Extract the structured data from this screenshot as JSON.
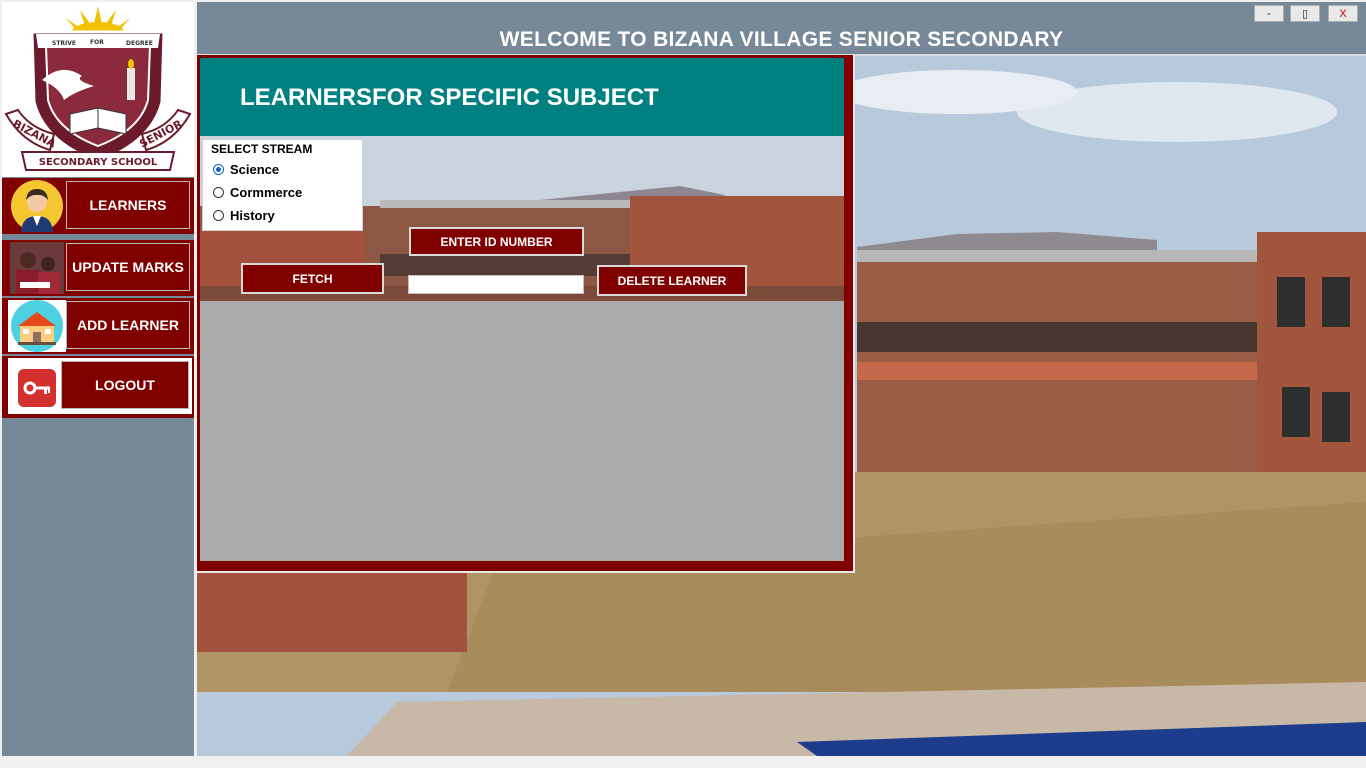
{
  "window": {
    "title": "WELCOME TO BIZANA VILLAGE SENIOR SECONDARY",
    "minimize_label": "-",
    "maximize_label": "▯",
    "close_label": "X"
  },
  "logo": {
    "motto_left": "STRIVE",
    "motto_center": "FOR",
    "motto_right": "DEGREE",
    "banner_left": "BIZANA",
    "banner_right": "SENIOR",
    "banner_bottom": "SECONDARY SCHOOL"
  },
  "sidebar": {
    "items": [
      {
        "label": "LEARNERS",
        "icon": "student-avatar-icon"
      },
      {
        "label": "UPDATE MARKS",
        "icon": "students-photo-icon"
      },
      {
        "label": "ADD LEARNER",
        "icon": "school-building-icon"
      },
      {
        "label": "LOGOUT",
        "icon": "key-icon"
      }
    ]
  },
  "panel": {
    "title": "LEARNERSFOR SPECIFIC SUBJECT",
    "stream_group": {
      "legend": "SELECT STREAM",
      "options": [
        "Science",
        "Cormmerce",
        "History"
      ],
      "selected": "Science"
    },
    "enter_id_label": "ENTER ID NUMBER",
    "id_input_value": "",
    "fetch_label": "FETCH",
    "delete_label": "DELETE LEARNER"
  },
  "colors": {
    "maroon": "#800000",
    "teal": "#008080",
    "slate": "#778899",
    "grid_gray": "#ababab",
    "radio_accent": "#0b63c4"
  }
}
